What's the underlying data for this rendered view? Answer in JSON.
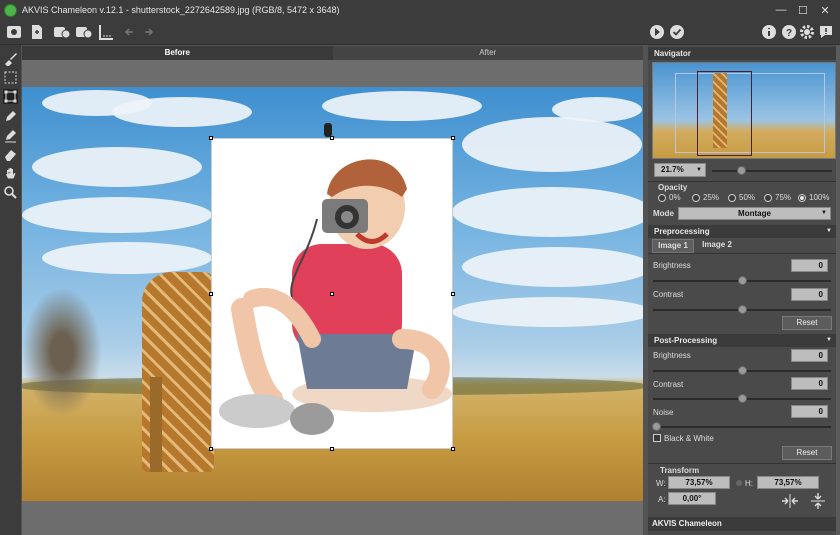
{
  "app": {
    "title": "AKVIS Chameleon v.12.1 - shutterstock_2272642589.jpg (RGB/8, 5472 x 3648)"
  },
  "window": {
    "minimize": "—",
    "maximize": "☐",
    "close": "✕"
  },
  "tabs": {
    "before": "Before",
    "after": "After"
  },
  "navigator": {
    "title": "Navigator",
    "zoom": "21.7%",
    "zoom_fraction": 0.4
  },
  "opacity": {
    "title": "Opacity",
    "options": [
      "0%",
      "25%",
      "50%",
      "75%",
      "100%"
    ],
    "selected": "100%"
  },
  "mode": {
    "label": "Mode",
    "value": "Montage"
  },
  "preprocessing": {
    "title": "Preprocessing",
    "tabs": [
      "Image 1",
      "Image 2"
    ],
    "active_tab": "Image 1",
    "brightness_label": "Brightness",
    "brightness": "0",
    "contrast_label": "Contrast",
    "contrast": "0",
    "reset": "Reset"
  },
  "postprocessing": {
    "title": "Post-Processing",
    "brightness_label": "Brightness",
    "brightness": "0",
    "contrast_label": "Contrast",
    "contrast": "0",
    "noise_label": "Noise",
    "noise": "0",
    "bw_label": "Black & White",
    "reset": "Reset"
  },
  "transform": {
    "title": "Transform",
    "w_label": "W:",
    "w": "73,57%",
    "h_label": "H:",
    "h": "73,57%",
    "a_label": "A:",
    "a": "0,00°"
  },
  "footer": {
    "label": "AKVIS Chameleon"
  }
}
